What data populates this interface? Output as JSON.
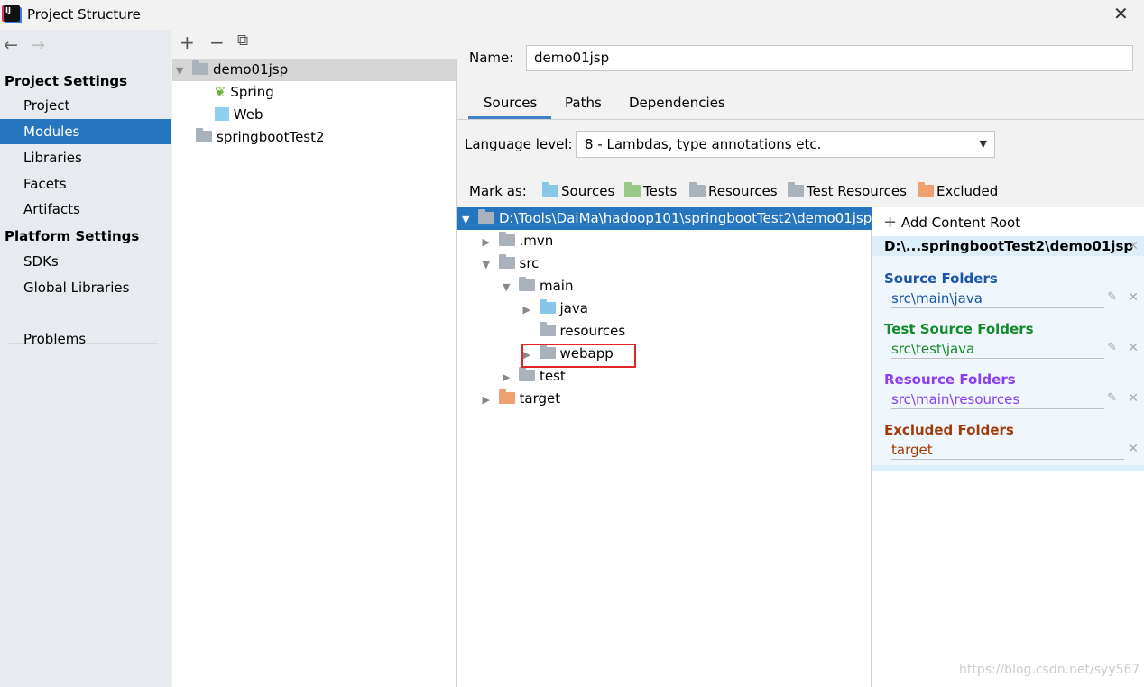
{
  "window": {
    "title": "Project Structure",
    "close": "✕"
  },
  "nav": {
    "back": "←",
    "forward": "→"
  },
  "sidebar": {
    "project_settings": "Project Settings",
    "items": [
      {
        "label": "Project"
      },
      {
        "label": "Modules",
        "selected": true
      },
      {
        "label": "Libraries"
      },
      {
        "label": "Facets"
      },
      {
        "label": "Artifacts"
      }
    ],
    "platform_settings": "Platform Settings",
    "platform_items": [
      {
        "label": "SDKs"
      },
      {
        "label": "Global Libraries"
      }
    ],
    "problems": "Problems"
  },
  "modules": {
    "toolbar": {
      "add": "+",
      "remove": "−",
      "copy": "⧉"
    },
    "tree": [
      {
        "label": "demo01jsp",
        "selected": true
      },
      {
        "label": "Spring"
      },
      {
        "label": "Web"
      },
      {
        "label": "springbootTest2"
      }
    ]
  },
  "editor": {
    "name_label": "Name:",
    "name_value": "demo01jsp",
    "tabs": [
      {
        "label": "Sources",
        "active": true
      },
      {
        "label": "Paths"
      },
      {
        "label": "Dependencies"
      }
    ],
    "language_label": "Language level:",
    "language_value": "8 - Lambdas, type annotations etc.",
    "mark_as_label": "Mark as:",
    "mark_as": [
      {
        "label": "Sources",
        "color": "#87c8e8"
      },
      {
        "label": "Tests",
        "color": "#98c987"
      },
      {
        "label": "Resources",
        "color": "#a9b2ba"
      },
      {
        "label": "Test Resources",
        "color": "#a9b2ba"
      },
      {
        "label": "Excluded",
        "color": "#f0a070"
      }
    ],
    "tree": [
      {
        "label": "D:\\Tools\\DaiMa\\hadoop101\\springbootTest2\\demo01jsp",
        "level": 0,
        "expanded": true
      },
      {
        "label": ".mvn",
        "level": 1,
        "expanded": false
      },
      {
        "label": "src",
        "level": 1,
        "expanded": true
      },
      {
        "label": "main",
        "level": 2,
        "expanded": true
      },
      {
        "label": "java",
        "level": 3,
        "expanded": false,
        "color": "#87c8e8"
      },
      {
        "label": "resources",
        "level": 3
      },
      {
        "label": "webapp",
        "level": 3,
        "expanded": false,
        "highlighted": true
      },
      {
        "label": "test",
        "level": 2,
        "expanded": false
      },
      {
        "label": "target",
        "level": 1,
        "expanded": false,
        "color": "#f0a070"
      }
    ]
  },
  "content_root": {
    "add_label": "Add Content Root",
    "root": "D:\\...springbootTest2\\demo01jsp",
    "groups": [
      {
        "title": "Source Folders",
        "path": "src\\main\\java",
        "color": "#1a55a8"
      },
      {
        "title": "Test Source Folders",
        "path": "src\\test\\java",
        "color": "#138a2c"
      },
      {
        "title": "Resource Folders",
        "path": "src\\main\\resources",
        "color": "#8a3ef0"
      },
      {
        "title": "Excluded Folders",
        "path": "target",
        "color": "#a23a08"
      }
    ]
  },
  "watermark": "https://blog.csdn.net/syy567"
}
